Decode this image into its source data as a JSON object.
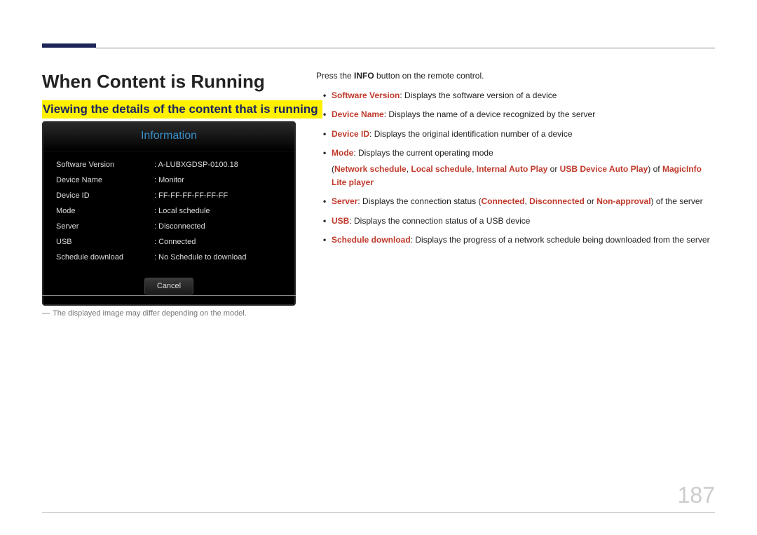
{
  "page_title": "When Content is Running",
  "subheading": "Viewing the details of the content that is running",
  "info_panel": {
    "title": "Information",
    "rows": [
      {
        "label": "Software Version",
        "value": "A-LUBXGDSP-0100.18"
      },
      {
        "label": "Device Name",
        "value": "Monitor"
      },
      {
        "label": "Device ID",
        "value": "FF-FF-FF-FF-FF-FF"
      },
      {
        "label": "Mode",
        "value": "Local schedule"
      },
      {
        "label": "Server",
        "value": "Disconnected"
      },
      {
        "label": "USB",
        "value": "Connected"
      },
      {
        "label": "Schedule download",
        "value": "No Schedule to download"
      }
    ],
    "cancel": "Cancel"
  },
  "footnote_dash": "―",
  "footnote": "The displayed image may differ depending on the model.",
  "intro_pre": "Press the ",
  "intro_bold": "INFO",
  "intro_post": " button on the remote control.",
  "bullets": {
    "sv_key": "Software Version",
    "sv_text": ": Displays the software version of a device",
    "dn_key": "Device Name",
    "dn_text": ": Displays the name of a device recognized by the server",
    "di_key": "Device ID",
    "di_text": ": Displays the original identification number of a device",
    "mode_key": "Mode",
    "mode_text": ": Displays the current operating mode",
    "mode2_open": "(",
    "mode2_ns": "Network schedule",
    "mode2_c1": ", ",
    "mode2_ls": "Local schedule",
    "mode2_c2": ", ",
    "mode2_iap": "Internal Auto Play",
    "mode2_or": " or ",
    "mode2_uap": "USB Device Auto Play",
    "mode2_of": ") of ",
    "mode2_mil": "MagicInfo Lite player",
    "srv_key": "Server",
    "srv_pre": ": Displays the connection status (",
    "srv_con": "Connected",
    "srv_c1": ", ",
    "srv_dis": "Disconnected",
    "srv_or": " or ",
    "srv_na": "Non-approval",
    "srv_post": ") of the server",
    "usb_key": "USB",
    "usb_text": ": Displays the connection status of a USB device",
    "sd_key": "Schedule download",
    "sd_text": ": Displays the progress of a network schedule being downloaded from the server"
  },
  "page_number": "187"
}
